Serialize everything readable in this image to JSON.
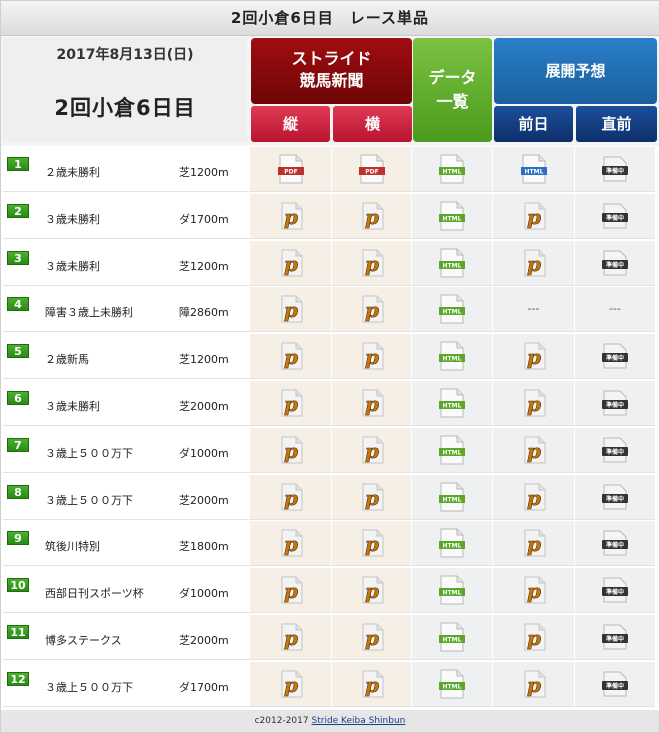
{
  "title": "2回小倉6日目　レース単品",
  "header": {
    "date": "2017年8月13日(日)",
    "race_day": "2回小倉6日目",
    "stride_line1": "ストライド",
    "stride_line2": "競馬新聞",
    "data_line1": "データ",
    "data_line2": "一覧",
    "tenkai": "展開予想",
    "sub_tate": "縦",
    "sub_yoko": "横",
    "sub_zenjitsu": "前日",
    "sub_chokuzen": "直前"
  },
  "icons": {
    "pdf": "PDF",
    "html": "HTML",
    "junbi": "準備中",
    "dash": "---"
  },
  "races": [
    {
      "num": "1",
      "name": "２歳未勝利",
      "dist": "芝1200m",
      "tate": "pdf",
      "yoko": "pdf",
      "data": "html",
      "zen": "html",
      "choku": "junbi"
    },
    {
      "num": "2",
      "name": "３歳未勝利",
      "dist": "ダ1700m",
      "tate": "p",
      "yoko": "p",
      "data": "html",
      "zen": "p",
      "choku": "junbi"
    },
    {
      "num": "3",
      "name": "３歳未勝利",
      "dist": "芝1200m",
      "tate": "p",
      "yoko": "p",
      "data": "html",
      "zen": "p",
      "choku": "junbi"
    },
    {
      "num": "4",
      "name": "障害３歳上未勝利",
      "dist": "障2860m",
      "tate": "p",
      "yoko": "p",
      "data": "html",
      "zen": "dash",
      "choku": "dash"
    },
    {
      "num": "5",
      "name": "２歳新馬",
      "dist": "芝1200m",
      "tate": "p",
      "yoko": "p",
      "data": "html",
      "zen": "p",
      "choku": "junbi"
    },
    {
      "num": "6",
      "name": "３歳未勝利",
      "dist": "芝2000m",
      "tate": "p",
      "yoko": "p",
      "data": "html",
      "zen": "p",
      "choku": "junbi"
    },
    {
      "num": "7",
      "name": "３歳上５００万下",
      "dist": "ダ1000m",
      "tate": "p",
      "yoko": "p",
      "data": "html",
      "zen": "p",
      "choku": "junbi"
    },
    {
      "num": "8",
      "name": "３歳上５００万下",
      "dist": "芝2000m",
      "tate": "p",
      "yoko": "p",
      "data": "html",
      "zen": "p",
      "choku": "junbi"
    },
    {
      "num": "9",
      "name": "筑後川特別",
      "dist": "芝1800m",
      "tate": "p",
      "yoko": "p",
      "data": "html",
      "zen": "p",
      "choku": "junbi"
    },
    {
      "num": "10",
      "name": "西部日刊スポーツ杯",
      "dist": "ダ1000m",
      "tate": "p",
      "yoko": "p",
      "data": "html",
      "zen": "p",
      "choku": "junbi"
    },
    {
      "num": "11",
      "name": "博多ステークス",
      "dist": "芝2000m",
      "tate": "p",
      "yoko": "p",
      "data": "html",
      "zen": "p",
      "choku": "junbi"
    },
    {
      "num": "12",
      "name": "３歳上５００万下",
      "dist": "ダ1700m",
      "tate": "p",
      "yoko": "p",
      "data": "html",
      "zen": "p",
      "choku": "junbi"
    }
  ],
  "footer": {
    "copyright": "c2012-2017",
    "link": "Stride Keiba Shinbun"
  },
  "colors": {
    "stride": "#8a0a0c",
    "data": "#5aaa26",
    "tenkai": "#2270b8",
    "sub_pink": "#c8203d",
    "sub_navy": "#143d80",
    "pdf_red": "#c0302a",
    "html_green": "#5aa82a",
    "html_blue": "#2a70c0"
  }
}
